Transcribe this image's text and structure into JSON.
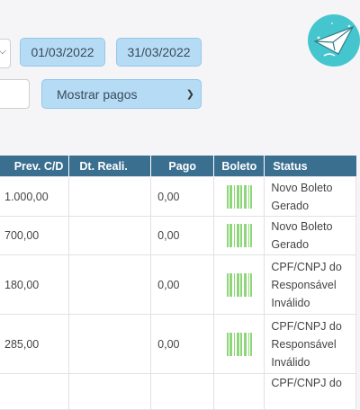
{
  "filters": {
    "date_start": "01/03/2022",
    "date_end": "31/03/2022",
    "status_filter": "Mostrar pagos"
  },
  "colors": {
    "header_bg": "#3a6f8f",
    "filter_bg": "#b6dcf5",
    "barcode": "#8fd67a",
    "logo_bg": "#45c6cf"
  },
  "table": {
    "headers": [
      "Prev. C/D",
      "Dt. Reali.",
      "Pago",
      "Boleto",
      "Status"
    ],
    "rows": [
      {
        "prev": "1.000,00",
        "dt_reali": "",
        "pago": "0,00",
        "boleto_icon": "barcode-icon",
        "status": [
          "Novo Boleto",
          "Gerado"
        ]
      },
      {
        "prev": "700,00",
        "dt_reali": "",
        "pago": "0,00",
        "boleto_icon": "barcode-icon",
        "status": [
          "Novo Boleto",
          "Gerado"
        ]
      },
      {
        "prev": "180,00",
        "dt_reali": "",
        "pago": "0,00",
        "boleto_icon": "barcode-icon",
        "status": [
          "CPF/CNPJ do",
          "Responsável",
          "Inválido"
        ]
      },
      {
        "prev": "285,00",
        "dt_reali": "",
        "pago": "0,00",
        "boleto_icon": "barcode-icon",
        "status": [
          "CPF/CNPJ do",
          "Responsável",
          "Inválido"
        ]
      },
      {
        "prev": "",
        "dt_reali": "",
        "pago": "",
        "boleto_icon": "",
        "status": [
          "CPF/CNPJ do"
        ]
      }
    ]
  }
}
